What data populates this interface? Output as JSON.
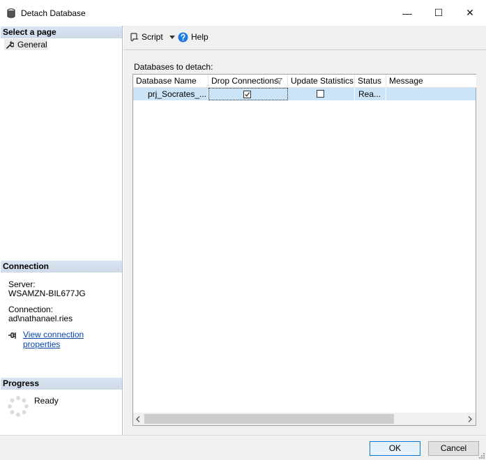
{
  "window": {
    "title": "Detach Database",
    "minimize_glyph": "—",
    "maximize_glyph": "☐",
    "close_glyph": "✕"
  },
  "left": {
    "select_page_header": "Select a page",
    "pages": [
      {
        "label": "General",
        "icon": "wrench-icon"
      }
    ],
    "connection_header": "Connection",
    "server_label": "Server:",
    "server_value": "WSAMZN-BIL677JG",
    "connection_label": "Connection:",
    "connection_value": "ad\\nathanael.ries",
    "view_connection_link": "View connection properties",
    "progress_header": "Progress",
    "progress_status": "Ready"
  },
  "toolbar": {
    "script_label": "Script",
    "help_label": "Help"
  },
  "grid": {
    "caption": "Databases to detach:",
    "columns": [
      "Database Name",
      "Drop Connections",
      "Update Statistics",
      "Status",
      "Message"
    ],
    "rows": [
      {
        "database_name": "prj_Socrates_...",
        "drop_connections": true,
        "update_statistics": false,
        "status": "Rea...",
        "message": ""
      }
    ]
  },
  "buttons": {
    "ok": "OK",
    "cancel": "Cancel"
  },
  "colors": {
    "section_header": "#d3dfee",
    "row_selected": "#cce4f7",
    "link": "#0645ad",
    "help_icon": "#1e7be0",
    "ok_border": "#0078d7"
  }
}
